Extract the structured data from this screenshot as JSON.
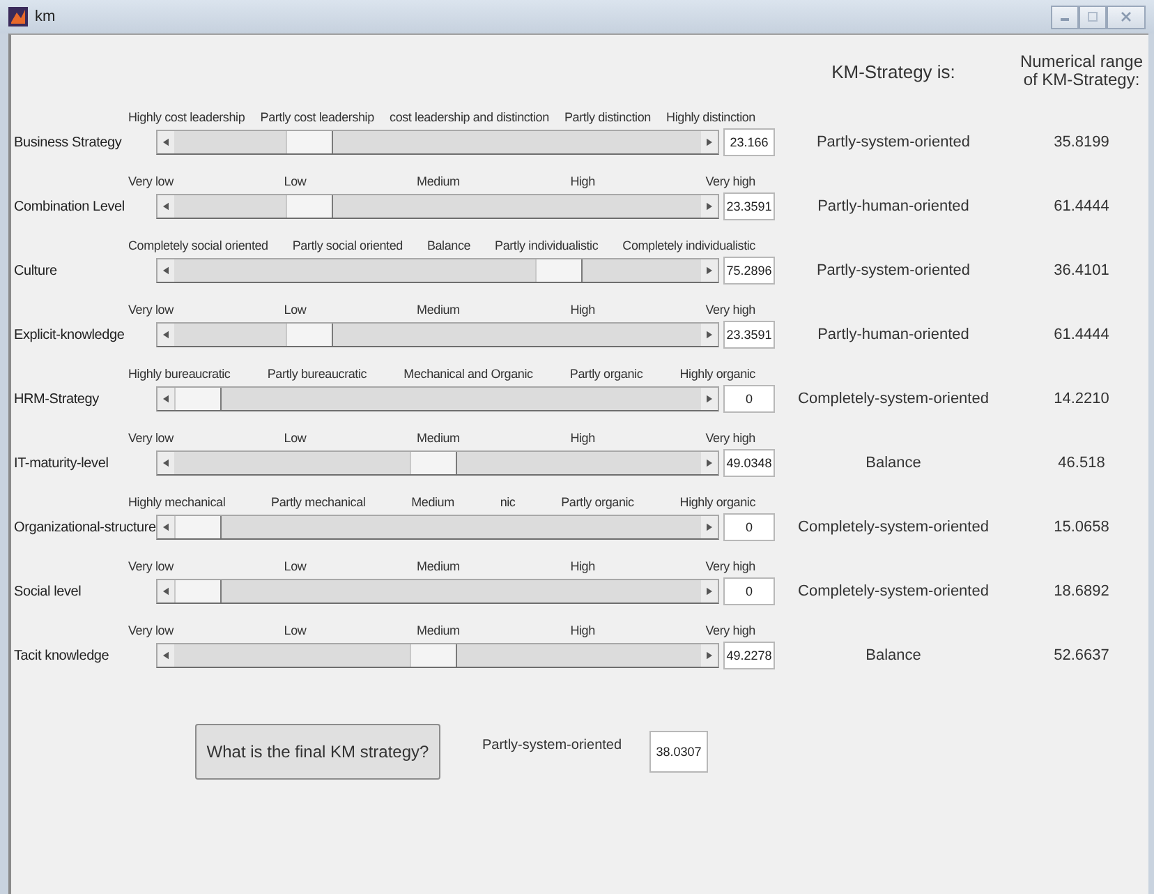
{
  "window": {
    "title": "km"
  },
  "headers": {
    "strategy": "KM-Strategy is:",
    "range": "Numerical range of KM-Strategy:"
  },
  "rows": [
    {
      "name": "Business Strategy",
      "scale": [
        "Highly cost leadership",
        "Partly cost leadership",
        "cost leadership and distinction",
        "Partly distinction",
        "Highly distinction"
      ],
      "level": 0.23166,
      "value": "23.166",
      "strategy": "Partly-system-oriented",
      "range": "35.8199"
    },
    {
      "name": "Combination Level",
      "scale": [
        "Very low",
        "Low",
        "Medium",
        "High",
        "Very high"
      ],
      "level": 0.233591,
      "value": "23.3591",
      "strategy": "Partly-human-oriented",
      "range": "61.4444"
    },
    {
      "name": "Culture",
      "scale": [
        "Completely social oriented",
        "Partly social oriented",
        "Balance",
        "Partly individualistic",
        "Completely individualistic"
      ],
      "level": 0.752896,
      "value": "75.2896",
      "strategy": "Partly-system-oriented",
      "range": "36.4101"
    },
    {
      "name": "Explicit-knowledge",
      "scale": [
        "Very low",
        "Low",
        "Medium",
        "High",
        "Very high"
      ],
      "level": 0.233591,
      "value": "23.3591",
      "strategy": "Partly-human-oriented",
      "range": "61.4444"
    },
    {
      "name": "HRM-Strategy",
      "scale": [
        "Highly bureaucratic",
        "Partly bureaucratic",
        "Mechanical and Organic",
        "Partly organic",
        "Highly organic"
      ],
      "level": 0,
      "value": "0",
      "strategy": "Completely-system-oriented",
      "range": "14.2210"
    },
    {
      "name": "IT-maturity-level",
      "scale": [
        "Very low",
        "Low",
        "Medium",
        "High",
        "Very high"
      ],
      "level": 0.490348,
      "value": "49.0348",
      "strategy": "Balance",
      "range": "46.518"
    },
    {
      "name": "Organizational-structure",
      "scale": [
        "Highly mechanical",
        "Partly mechanical",
        "Medium",
        "nic",
        "Partly organic",
        "Highly organic"
      ],
      "level": 0,
      "value": "0",
      "strategy": "Completely-system-oriented",
      "range": "15.0658"
    },
    {
      "name": "Social level",
      "scale": [
        "Very low",
        "Low",
        "Medium",
        "High",
        "Very high"
      ],
      "level": 0,
      "value": "0",
      "strategy": "Completely-system-oriented",
      "range": "18.6892"
    },
    {
      "name": "Tacit knowledge",
      "scale": [
        "Very low",
        "Low",
        "Medium",
        "High",
        "Very high"
      ],
      "level": 0.492278,
      "value": "49.2278",
      "strategy": "Balance",
      "range": "52.6637"
    }
  ],
  "final": {
    "button": "What is the final KM strategy?",
    "strategy": "Partly-system-oriented",
    "value": "38.0307"
  }
}
